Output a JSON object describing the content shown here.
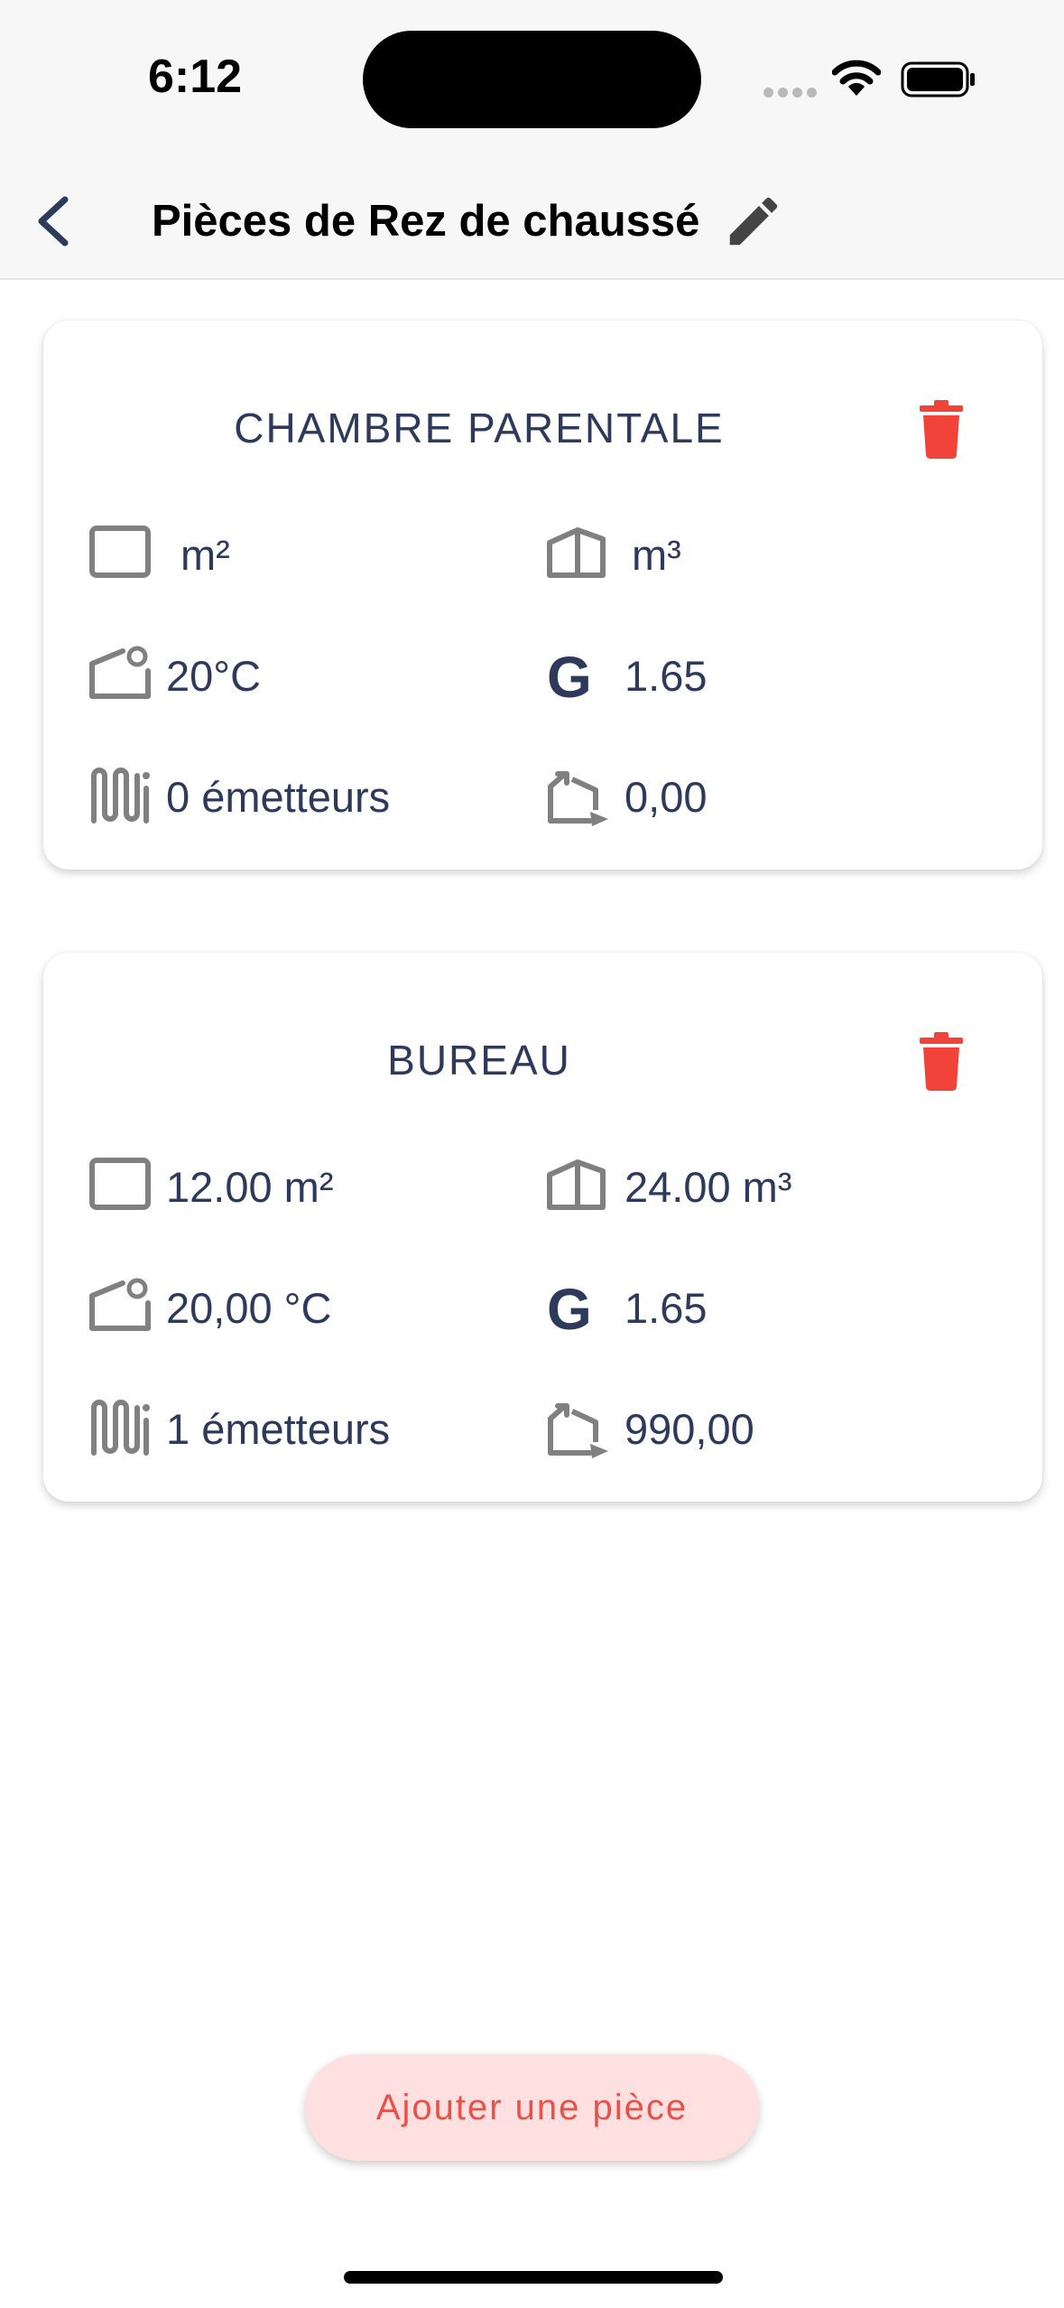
{
  "status_bar": {
    "time": "6:12"
  },
  "header": {
    "title": "Pièces de Rez de chaussé",
    "back_icon": "chevron-left-icon",
    "edit_icon": "pencil-icon"
  },
  "rooms": [
    {
      "name": "CHAMBRE PARENTALE",
      "surface": "m²",
      "volume": "m³",
      "temperature": "20°C",
      "g_coefficient": "1.65",
      "emitters": "0 émetteurs",
      "power": "0,00"
    },
    {
      "name": "BUREAU",
      "surface": "12.00 m²",
      "volume": "24.00 m³",
      "temperature": "20,00 °C",
      "g_coefficient": "1.65",
      "emitters": "1 émetteurs",
      "power": "990,00"
    }
  ],
  "icons": {
    "surface": "floor-area-icon",
    "volume": "room-volume-icon",
    "temperature": "room-temperature-icon",
    "g_coefficient": "g-coefficient-icon",
    "emitters": "radiator-icon",
    "power": "heat-loss-icon",
    "delete": "trash-icon"
  },
  "colors": {
    "text_primary": "#2e3a5c",
    "delete_red": "#f2433a",
    "button_bg": "#fde0df",
    "button_text": "#e8524a",
    "icon_gray": "#808080"
  },
  "actions": {
    "add_room_label": "Ajouter une pièce"
  }
}
